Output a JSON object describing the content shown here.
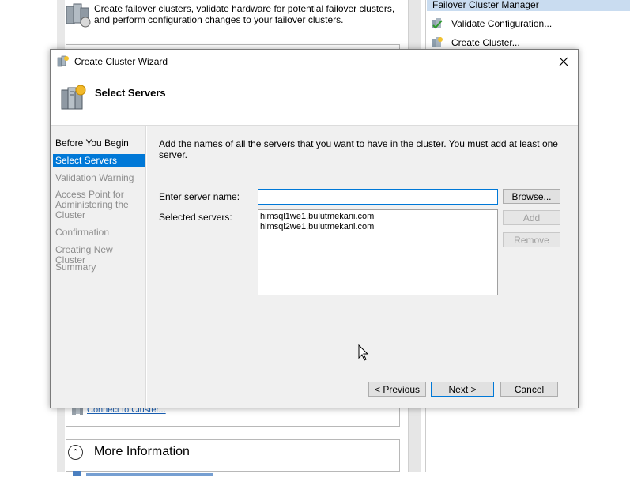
{
  "background": {
    "intro_text": "Create failover clusters, validate hardware for potential failover clusters, and perform configuration changes to your failover clusters.",
    "actions_header": "Failover Cluster Manager",
    "actions": [
      {
        "label": "Validate Configuration..."
      },
      {
        "label": "Create Cluster..."
      }
    ],
    "connect_link": "Connect to Cluster...",
    "more_info_title": "More Information"
  },
  "wizard": {
    "title": "Create Cluster Wizard",
    "page_title": "Select Servers",
    "nav": [
      {
        "label": "Before You Begin",
        "state": "done"
      },
      {
        "label": "Select Servers",
        "state": "active"
      },
      {
        "label": "Validation Warning",
        "state": "pending"
      },
      {
        "label": "Access Point for Administering the Cluster",
        "state": "pending"
      },
      {
        "label": "Confirmation",
        "state": "pending"
      },
      {
        "label": "Creating New Cluster",
        "state": "pending"
      },
      {
        "label": "Summary",
        "state": "pending"
      }
    ],
    "instructions": "Add the names of all the servers that you want to have in the cluster. You must add at least one server.",
    "server_name_label": "Enter server name:",
    "server_name_value": "",
    "selected_servers_label": "Selected servers:",
    "selected_servers": [
      "himsql1we1.bulutmekani.com",
      "himsql2we1.bulutmekani.com"
    ],
    "browse_label": "Browse...",
    "add_label": "Add",
    "remove_label": "Remove",
    "previous_label": "< Previous",
    "next_label": "Next >",
    "cancel_label": "Cancel"
  },
  "colors": {
    "accent": "#0078d7",
    "dialog_bg": "#f0f0f0",
    "disabled_text": "#a0a0a0",
    "link": "#1a5fb4"
  }
}
